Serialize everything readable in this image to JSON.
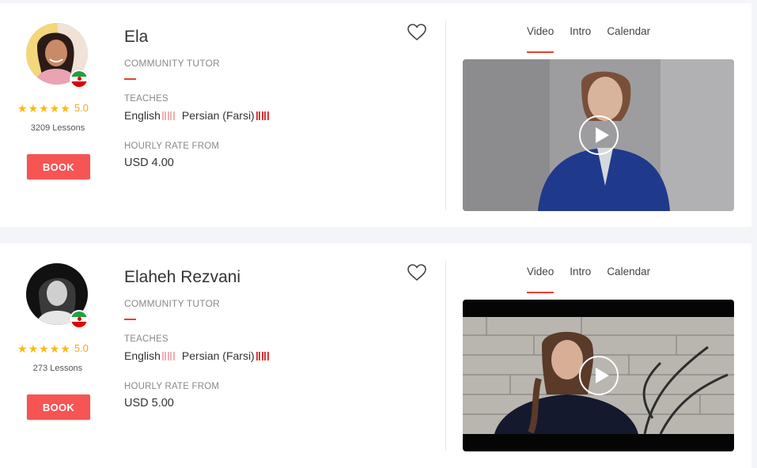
{
  "tutors": [
    {
      "name": "Ela",
      "type": "COMMUNITY TUTOR",
      "rating": "5.0",
      "lessons": "3209 Lessons",
      "book_label": "BOOK",
      "teaches_label": "TEACHES",
      "languages": [
        {
          "name": "English",
          "level": "partial"
        },
        {
          "name": "Persian (Farsi)",
          "level": "native"
        }
      ],
      "rate_label": "HOURLY RATE FROM",
      "rate": "USD 4.00",
      "tabs": [
        "Video",
        "Intro",
        "Calendar"
      ],
      "active_tab": "Video",
      "flag": "iran-flag"
    },
    {
      "name": "Elaheh Rezvani",
      "type": "COMMUNITY TUTOR",
      "rating": "5.0",
      "lessons": "273 Lessons",
      "book_label": "BOOK",
      "teaches_label": "TEACHES",
      "languages": [
        {
          "name": "English",
          "level": "partial"
        },
        {
          "name": "Persian (Farsi)",
          "level": "native"
        }
      ],
      "rate_label": "HOURLY RATE FROM",
      "rate": "USD 5.00",
      "tabs": [
        "Video",
        "Intro",
        "Calendar"
      ],
      "active_tab": "Video",
      "flag": "iran-flag"
    }
  ],
  "colors": {
    "accent": "#f75454",
    "star": "#fdb813",
    "rating_text": "#f5a623",
    "level_full": "#d9383a",
    "level_empty": "#f2b0b0"
  }
}
